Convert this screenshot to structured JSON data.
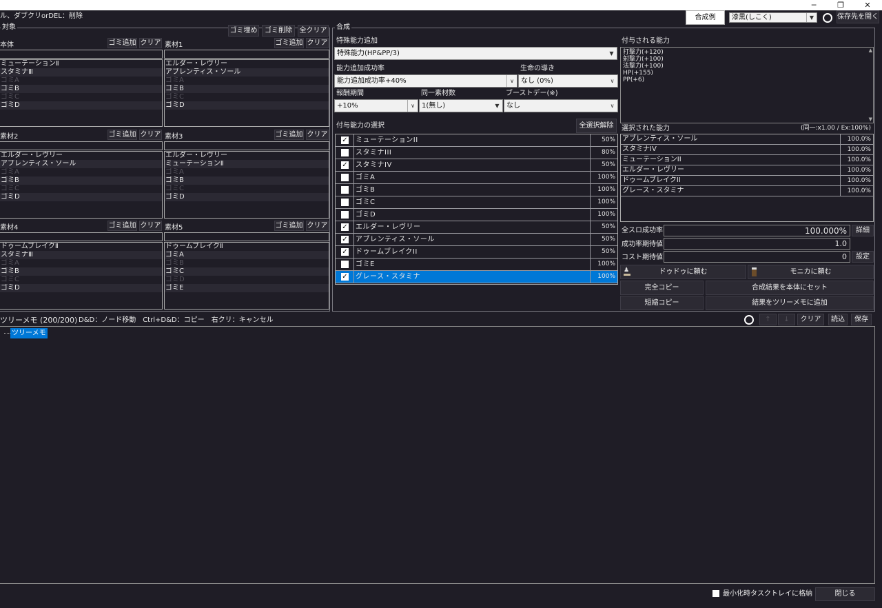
{
  "window": {
    "min_icon": "─",
    "restore_icon": "❐",
    "close_icon": "✕"
  },
  "hint": "ル、ダブクリorDEL：削除",
  "top_right": {
    "example_button": "合成例",
    "combo_value": "漆黒(しこく)",
    "open_save_button": "保存先を開く"
  },
  "target": {
    "legend": "対象",
    "fill_trash_button": "ゴミ埋め",
    "delete_trash_button": "ゴミ削除",
    "clear_all_button": "全クリア",
    "add_trash_label": "ゴミ追加",
    "clear_label": "クリア",
    "panels": [
      {
        "title": "本体",
        "items": [
          "ミューテーションⅡ",
          "スタミナⅢ",
          "ゴミA",
          "ゴミB",
          "ゴミC",
          "ゴミD"
        ]
      },
      {
        "title": "素材1",
        "items": [
          "エルダー・レヴリー",
          "アブレンティス・ソール",
          "ゴミA",
          "ゴミB",
          "ゴミC",
          "ゴミD"
        ]
      },
      {
        "title": "素材2",
        "items": [
          "エルダー・レヴリー",
          "アブレンティス・ソール",
          "ゴミA",
          "ゴミB",
          "ゴミC",
          "ゴミD"
        ]
      },
      {
        "title": "素材3",
        "items": [
          "エルダー・レヴリー",
          "ミューテーションⅡ",
          "ゴミA",
          "ゴミB",
          "ゴミC",
          "ゴミD"
        ]
      },
      {
        "title": "素材4",
        "items": [
          "ドゥームブレイクⅡ",
          "スタミナⅢ",
          "ゴミA",
          "ゴミB",
          "ゴミC",
          "ゴミD"
        ]
      },
      {
        "title": "素材5",
        "items": [
          "ドゥームブレイクⅡ",
          "ゴミA",
          "ゴミB",
          "ゴミC",
          "ゴミD",
          "ゴミE"
        ]
      }
    ]
  },
  "synth": {
    "legend": "合成",
    "special_label": "特殊能力追加",
    "special_value": "特殊能力(HP&PP/3)",
    "rate_label": "能力追加成功率",
    "rate_value": "能力追加成功率+40%",
    "life_label": "生命の導き",
    "life_value": "なし (0%)",
    "reward_label": "報酬期間",
    "reward_value": "+10%",
    "same_label": "同一素材数",
    "same_value": "1(無し)",
    "boost_label": "ブーストデー(※)",
    "boost_value": "なし",
    "select_label": "付与能力の選択",
    "deselect_button": "全選択解除",
    "abilities": [
      {
        "name": "ミューテーションII",
        "pct": "50%",
        "checked": true,
        "mark": "✓"
      },
      {
        "name": "スタミナIII",
        "pct": "80%",
        "checked": false,
        "mark": ""
      },
      {
        "name": "スタミナIV",
        "pct": "50%",
        "checked": true,
        "mark": "✓"
      },
      {
        "name": "ゴミA",
        "pct": "100%",
        "checked": false,
        "mark": ""
      },
      {
        "name": "ゴミB",
        "pct": "100%",
        "checked": false,
        "mark": ""
      },
      {
        "name": "ゴミC",
        "pct": "100%",
        "checked": false,
        "mark": ""
      },
      {
        "name": "ゴミD",
        "pct": "100%",
        "checked": false,
        "mark": ""
      },
      {
        "name": "エルダー・レヴリー",
        "pct": "50%",
        "checked": true,
        "mark": "✓"
      },
      {
        "name": "アブレンティス・ソール",
        "pct": "50%",
        "checked": true,
        "mark": "✓"
      },
      {
        "name": "ドゥームブレイクII",
        "pct": "50%",
        "checked": true,
        "mark": "✓"
      },
      {
        "name": "ゴミE",
        "pct": "100%",
        "checked": false,
        "mark": ""
      },
      {
        "name": "グレース・スタミナ",
        "pct": "100%",
        "checked": true,
        "mark": "✓",
        "selected": true
      }
    ],
    "granted_label": "付与される能力",
    "granted_lines": [
      "打撃力(+120)",
      "射撃力(+100)",
      "法撃力(+100)",
      "HP(+155)",
      "PP(+6)"
    ],
    "selected_label": "選択された能力",
    "selected_note": "(同一:x1.00 / Ex:100%)",
    "selected": [
      {
        "name": "アブレンティス・ソール",
        "pct": "100.0%"
      },
      {
        "name": "スタミナIV",
        "pct": "100.0%"
      },
      {
        "name": "ミューテーションII",
        "pct": "100.0%"
      },
      {
        "name": "エルダー・レヴリー",
        "pct": "100.0%"
      },
      {
        "name": "ドゥームブレイクII",
        "pct": "100.0%"
      },
      {
        "name": "グレース・スタミナ",
        "pct": "100.0%"
      }
    ],
    "all_rate_label": "全スロ成功率",
    "all_rate_value": "100.000%",
    "detail_button": "詳細",
    "expect_label": "成功率期待値",
    "expect_value": "1.0",
    "cost_label": "コスト期待値",
    "cost_value": "0",
    "setting_button": "設定",
    "ask_dudu": "ドゥドゥに頼む",
    "ask_monica": "モニカに頼む",
    "full_copy": "完全コピー",
    "set_to_base": "合成結果を本体にセット",
    "short_copy": "短縮コピー",
    "add_to_tree": "結果をツリーメモに追加"
  },
  "tree": {
    "title": "ツリーメモ (200/200)",
    "help": "D&D：ノード移動　Ctrl+D&D：コピー　右クリ：キャンセル",
    "up": "↑",
    "down": "↓",
    "clear_button": "クリア",
    "load_button": "読込",
    "save_button": "保存",
    "node": "ツリーメモ"
  },
  "footer": {
    "tray_label": "最小化時タスクトレイに格納",
    "close_button": "閉じる"
  }
}
